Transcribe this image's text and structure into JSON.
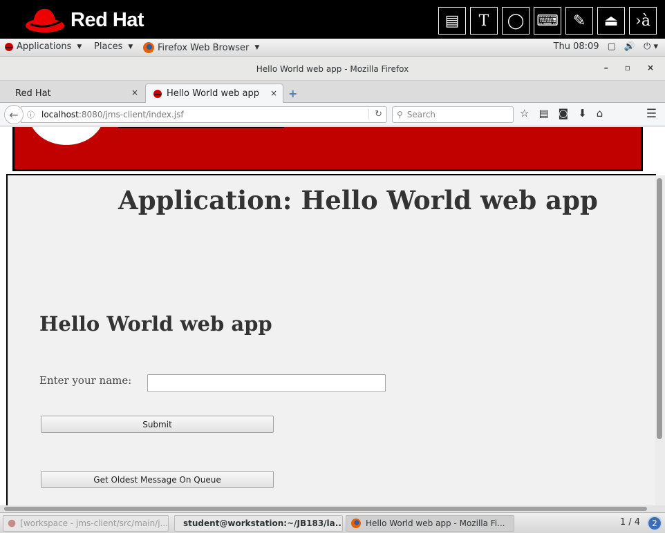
{
  "top_bar": {
    "brand": "Red Hat",
    "tools": [
      {
        "icon": "document-icon",
        "glyph": "▤"
      },
      {
        "icon": "text-tool-icon",
        "glyph": "T"
      },
      {
        "icon": "circle-tool-icon",
        "glyph": "◯"
      },
      {
        "icon": "keyboard-icon",
        "glyph": "⌨"
      },
      {
        "icon": "pen-disabled-icon",
        "glyph": "✎"
      },
      {
        "icon": "eject-icon",
        "glyph": "⏏"
      },
      {
        "icon": "input-method-icon",
        "glyph": "›à"
      }
    ]
  },
  "gnome_panel": {
    "applications": "Applications",
    "places": "Places",
    "browser_launcher": "Firefox Web Browser",
    "clock": "Thu 08:09"
  },
  "window": {
    "title": "Hello World web app - Mozilla Firefox",
    "minimize": "–",
    "maximize": "▫",
    "close": "×"
  },
  "tabs": [
    {
      "label": "Red Hat",
      "close": "×"
    },
    {
      "label": "Hello World web app",
      "close": "×"
    }
  ],
  "new_tab": "+",
  "navbar": {
    "url_host": "localhost",
    "url_path": ":8080/jms-client/index.jsf",
    "search_placeholder": "Search"
  },
  "page": {
    "app_title": "Application: Hello World web app",
    "heading": "Hello World web app",
    "name_label": "Enter your name:",
    "name_value": "",
    "submit_label": "Submit",
    "oldest_label": "Get Oldest Message On Queue"
  },
  "taskbar": {
    "items": [
      {
        "label": "[workspace - jms-client/src/main/j..."
      },
      {
        "label": "student@workstation:~/JB183/la..."
      },
      {
        "label": "Hello World web app - Mozilla Fi..."
      }
    ],
    "pager": "1 / 4",
    "workspace_badge": "2"
  },
  "colors": {
    "brand_red": "#c10000",
    "content_bg": "#f1f1f1"
  }
}
